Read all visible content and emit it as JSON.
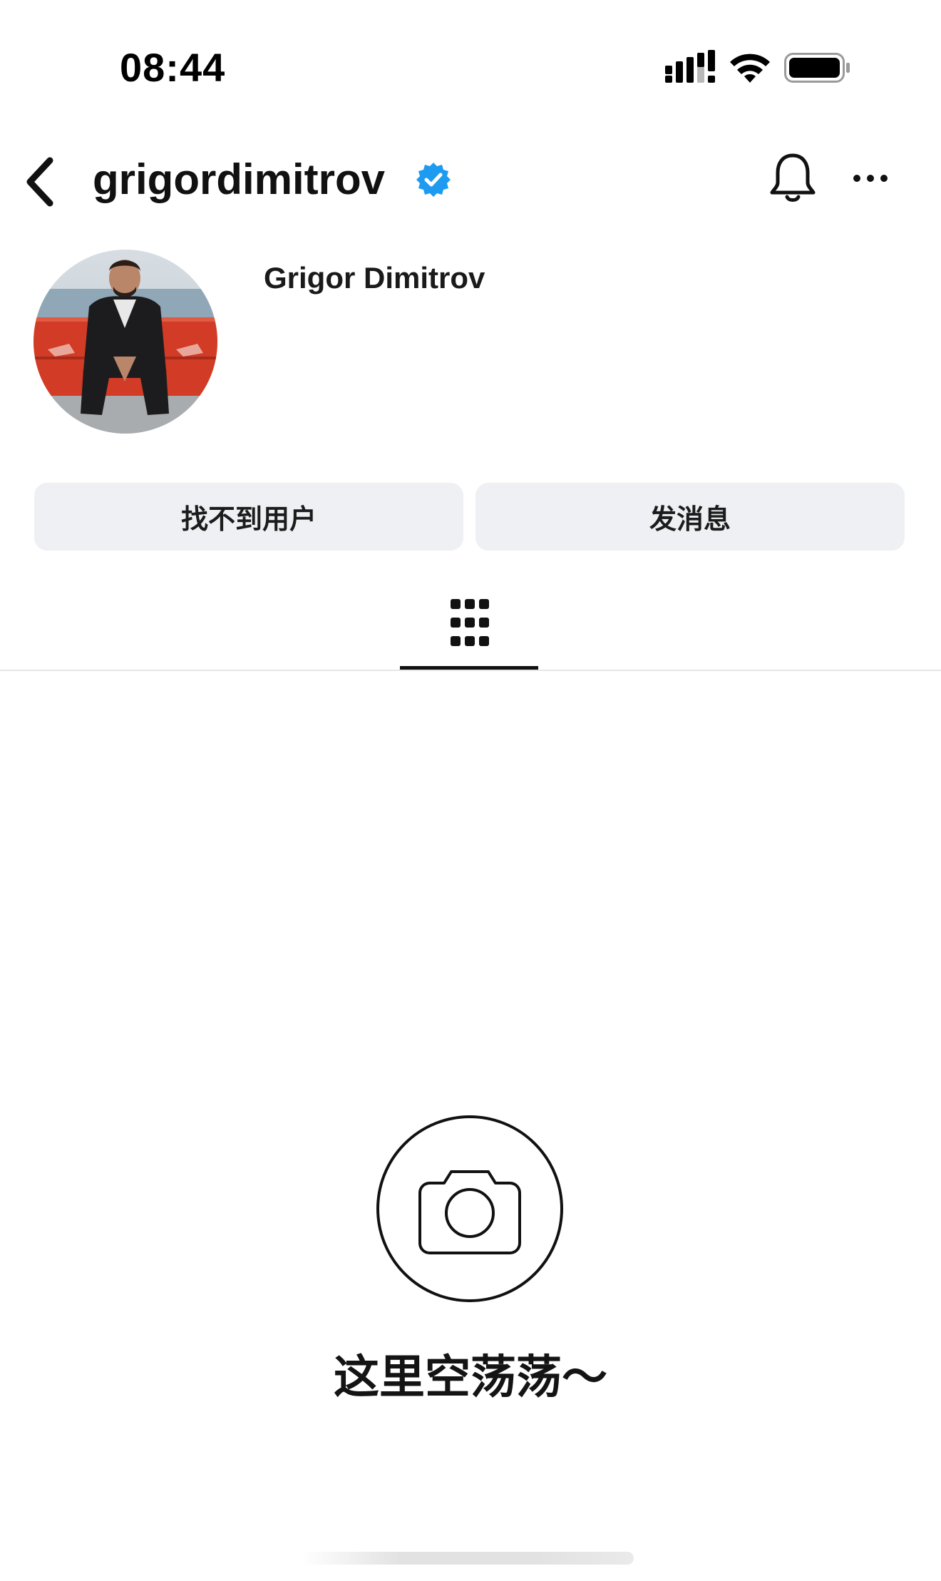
{
  "status_bar": {
    "time": "08:44",
    "icons": [
      "cellular-signal-icon",
      "wifi-icon",
      "battery-icon"
    ]
  },
  "header": {
    "back_icon": "chevron-left-icon",
    "username": "grigordimitrov",
    "verified_icon": "verified-badge-icon",
    "verified_color": "#1d9bf0",
    "notification_icon": "bell-icon",
    "more_icon": "more-horizontal-icon"
  },
  "profile": {
    "avatar_icon": "profile-photo",
    "display_name": "Grigor Dimitrov"
  },
  "actions": {
    "primary_label": "找不到用户",
    "secondary_label": "发消息",
    "button_color": "#eff0f3"
  },
  "tabs": {
    "active_icon": "grid-icon"
  },
  "empty_state": {
    "icon": "camera-icon",
    "message": "这里空荡荡～"
  }
}
